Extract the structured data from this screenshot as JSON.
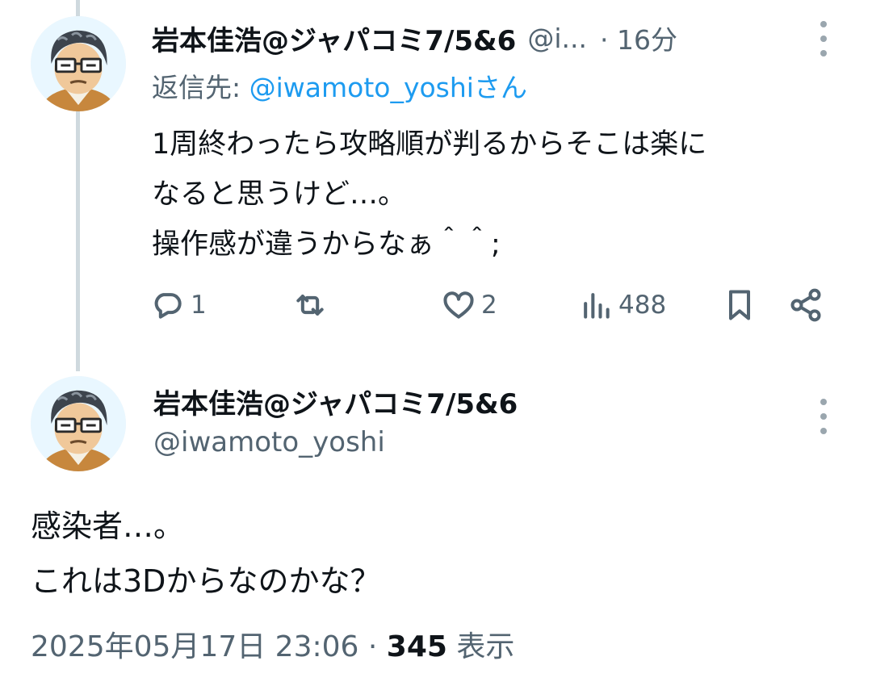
{
  "reply_tweet": {
    "display_name": "岩本佳浩@ジャパコミ7/5&6",
    "handle_truncated": "@i...",
    "time": "· 16分",
    "replying_prefix": "返信先: ",
    "replying_to": "@iwamoto_yoshiさん",
    "lines": [
      "1周終わったら攻略順が判るからそこは楽に",
      "なると思うけど…。",
      "操作感が違うからなぁ＾＾;"
    ],
    "actions": {
      "reply_count": "1",
      "retweet_count": "",
      "like_count": "2",
      "view_count": "488"
    }
  },
  "main_tweet": {
    "display_name": "岩本佳浩@ジャパコミ7/5&6",
    "handle": "@iwamoto_yoshi",
    "lines": [
      "感染者…。",
      "これは3Dからなのかな？"
    ],
    "timestamp": "2025年05月17日 23:06",
    "separator": " · ",
    "views_count": "345",
    "views_label": " 表示"
  },
  "icons": {
    "more": "more-vertical-icon",
    "reply": "reply-icon",
    "retweet": "retweet-icon",
    "like": "heart-icon",
    "views": "analytics-icon",
    "bookmark": "bookmark-icon",
    "share": "share-icon"
  },
  "colors": {
    "text": "#0f1419",
    "secondary": "#536471",
    "link": "#1d9bf0",
    "thread_line": "#cfd9de"
  }
}
